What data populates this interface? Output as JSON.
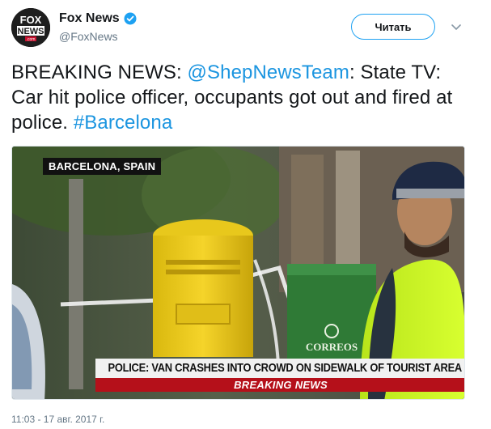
{
  "account": {
    "display_name": "Fox News",
    "handle": "@FoxNews",
    "logo_text_top": "FOX",
    "logo_text_bottom": "NEWS",
    "logo_text_com": ".com"
  },
  "header": {
    "follow_label": "Читать"
  },
  "tweet": {
    "text_prefix": "BREAKING NEWS: ",
    "mention": "@ShepNewsTeam",
    "text_middle": ": State TV: Car hit police officer, occupants got out and fired at police. ",
    "hashtag": "#Barcelona"
  },
  "media": {
    "location_tag": "BARCELONA, SPAIN",
    "headline": "POLICE: VAN CRASHES INTO CROWD ON SIDEWALK OF TOURIST AREA",
    "breaking_label": "BREAKING NEWS",
    "mailbox_text": "CORREOS"
  },
  "footer": {
    "timestamp": "11:03 - 17 авг. 2017 г."
  },
  "colors": {
    "link": "#1b95e0",
    "verified": "#1da1f2",
    "breaking_red": "#b5101a",
    "muted": "#657786"
  }
}
